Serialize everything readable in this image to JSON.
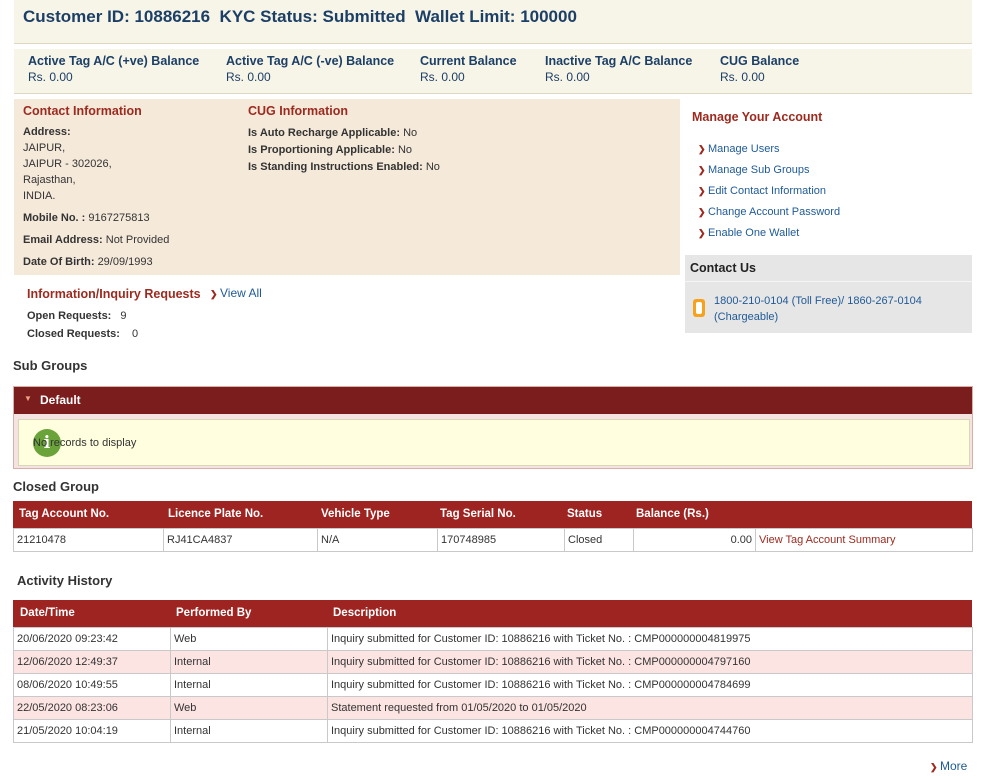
{
  "header": {
    "title": "Customer ID: 10886216  KYC Status: Submitted  Wallet Limit: 100000"
  },
  "balances": [
    {
      "label": "Active Tag A/C (+ve) Balance",
      "value": "Rs. 0.00"
    },
    {
      "label": "Active Tag A/C (-ve) Balance",
      "value": "Rs. 0.00"
    },
    {
      "label": "Current Balance",
      "value": "Rs. 0.00"
    },
    {
      "label": "Inactive Tag A/C Balance",
      "value": "Rs. 0.00"
    },
    {
      "label": "CUG Balance",
      "value": "Rs. 0.00"
    }
  ],
  "contact_info": {
    "title": "Contact Information",
    "address_label": "Address:",
    "address_lines": [
      "JAIPUR,",
      "JAIPUR - 302026,",
      "Rajasthan,",
      "INDIA."
    ],
    "mobile_label": "Mobile No. :",
    "mobile": "9167275813",
    "email_label": "Email Address:",
    "email": "Not Provided",
    "dob_label": "Date Of Birth:",
    "dob": "29/09/1993"
  },
  "cug_info": {
    "title": "CUG Information",
    "items": [
      {
        "label": "Is Auto Recharge Applicable:",
        "value": "No"
      },
      {
        "label": "Is Proportioning Applicable:",
        "value": "No"
      },
      {
        "label": "Is Standing Instructions Enabled:",
        "value": "No"
      }
    ]
  },
  "manage": {
    "title": "Manage Your Account",
    "links": [
      "Manage Users",
      "Manage Sub Groups",
      "Edit Contact Information",
      "Change Account Password",
      "Enable One Wallet"
    ]
  },
  "contact_us": {
    "title": "Contact Us",
    "line1": "1800-210-0104 (Toll Free)/ 1860-267-0104",
    "line2": "(Chargeable)"
  },
  "inquiry": {
    "title": "Information/Inquiry Requests",
    "view_all": "View All",
    "open_label": "Open Requests:",
    "open_value": "9",
    "closed_label": "Closed Requests:",
    "closed_value": "0"
  },
  "sub_groups": {
    "title": "Sub Groups",
    "panel_title": "Default",
    "empty_text": "No records to display"
  },
  "closed_group": {
    "title": "Closed Group",
    "headers": [
      "Tag Account No.",
      "Licence Plate No.",
      "Vehicle Type",
      "Tag Serial No.",
      "Status",
      "Balance (Rs.)"
    ],
    "rows": [
      {
        "account": "21210478",
        "plate": "RJ41CA4837",
        "vehicle": "N/A",
        "serial": "170748985",
        "status": "Closed",
        "balance": "0.00",
        "link": "View Tag Account Summary"
      }
    ]
  },
  "activity": {
    "title": "Activity History",
    "headers": [
      "Date/Time",
      "Performed By",
      "Description"
    ],
    "rows": [
      {
        "date": "20/06/2020 09:23:42",
        "by": "Web",
        "desc": "Inquiry submitted for Customer ID: 10886216 with Ticket No. : CMP000000004819975"
      },
      {
        "date": "12/06/2020 12:49:37",
        "by": "Internal",
        "desc": "Inquiry submitted for Customer ID: 10886216 with Ticket No. : CMP000000004797160"
      },
      {
        "date": "08/06/2020 10:49:55",
        "by": "Internal",
        "desc": "Inquiry submitted for Customer ID: 10886216 with Ticket No. : CMP000000004784699"
      },
      {
        "date": "22/05/2020 08:23:06",
        "by": "Web",
        "desc": "Statement requested from 01/05/2020 to 01/05/2020"
      },
      {
        "date": "21/05/2020 10:04:19",
        "by": "Internal",
        "desc": "Inquiry submitted for Customer ID: 10886216 with Ticket No. : CMP000000004744760"
      }
    ],
    "more": "More"
  },
  "colors": {
    "brand": "#9d2420",
    "title_blue": "#1c3f66",
    "link_blue": "#1f5a96",
    "panel_beige": "#f5e9da"
  }
}
